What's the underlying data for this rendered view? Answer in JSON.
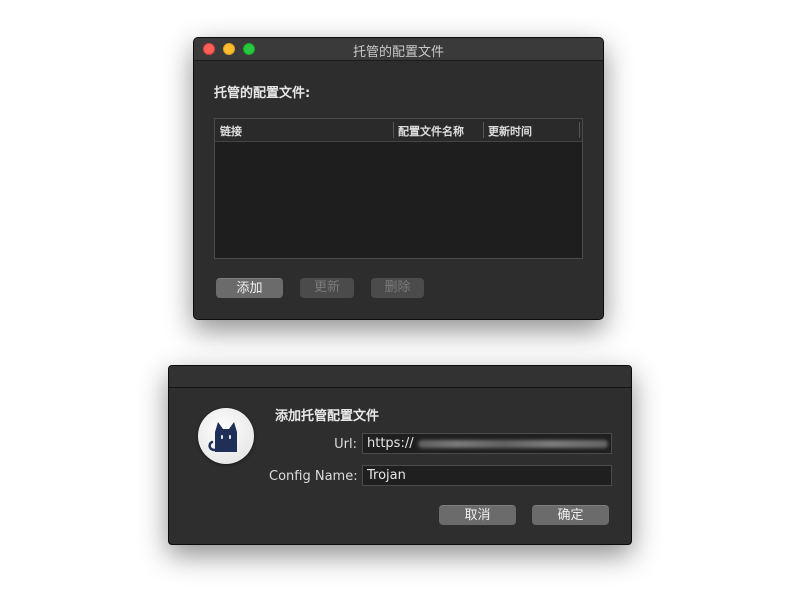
{
  "hosted_window": {
    "title": "托管的配置文件",
    "heading": "托管的配置文件:",
    "columns": [
      "链接",
      "配置文件名称",
      "更新时间"
    ],
    "buttons": {
      "add": "添加",
      "update": "更新",
      "delete": "删除"
    }
  },
  "add_dialog": {
    "title": "添加托管配置文件",
    "url_label": "Url:",
    "url_value": "https://",
    "name_label": "Config Name:",
    "name_value": "Trojan",
    "cancel": "取消",
    "ok": "确定"
  },
  "colors": {
    "window_bg": "#2d2d2d",
    "close": "#fe5f57",
    "minimize": "#febc2e",
    "zoom": "#28c840"
  },
  "icons": {
    "app": "clash-cat-icon"
  }
}
